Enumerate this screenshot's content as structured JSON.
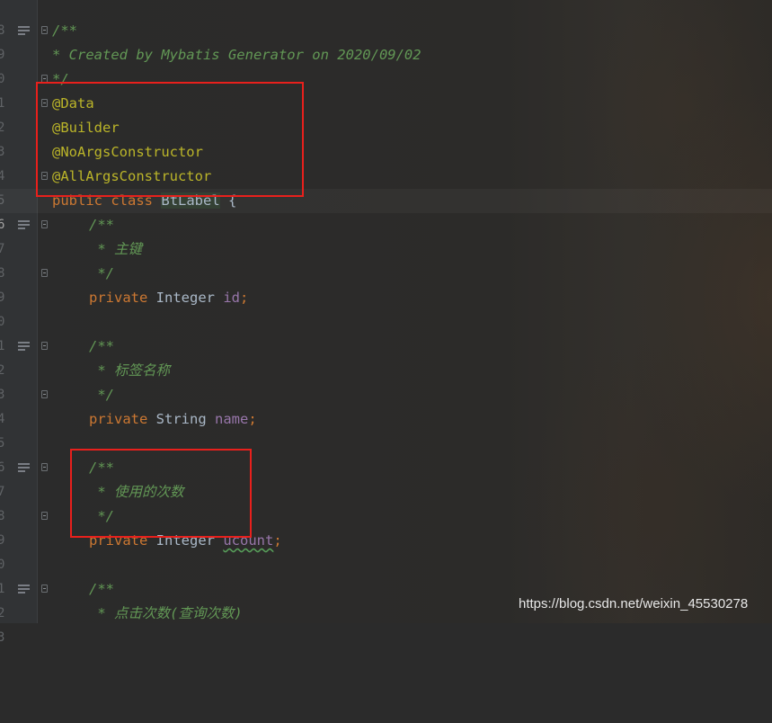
{
  "editor": {
    "lines": [
      {
        "n": "8"
      },
      {
        "n": "9",
        "doc": "/**"
      },
      {
        "n": "0",
        "doc": "* Created by Mybatis Generator on 2020/09/02"
      },
      {
        "n": "1",
        "doc": "*/"
      },
      {
        "n": "2",
        "ann": "@Data"
      },
      {
        "n": "3",
        "ann": "@Builder"
      },
      {
        "n": "4",
        "ann": "@NoArgsConstructor"
      },
      {
        "n": "5",
        "ann": "@AllArgsConstructor"
      },
      {
        "n": "6",
        "kw1": "public",
        "kw2": "class",
        "cls": "BtLabel",
        "rest": " {"
      },
      {
        "n": "7",
        "doc": "/**"
      },
      {
        "n": "8",
        "doc": " * 主键"
      },
      {
        "n": "9",
        "doc": " */"
      },
      {
        "n": "0",
        "kw": "private",
        "type": "Integer",
        "field": "id",
        "end": ";"
      },
      {
        "n": "1"
      },
      {
        "n": "2",
        "doc": "/**"
      },
      {
        "n": "3",
        "doc": " * 标签名称"
      },
      {
        "n": "4",
        "doc": " */"
      },
      {
        "n": "5",
        "kw": "private",
        "type": "String",
        "field": "name",
        "end": ";"
      },
      {
        "n": "6"
      },
      {
        "n": "7",
        "doc": "/**"
      },
      {
        "n": "8",
        "doc": " * 使用的次数"
      },
      {
        "n": "9",
        "doc": " */"
      },
      {
        "n": "0",
        "kw": "private",
        "type": "Integer",
        "field": "ucount",
        "end": ";"
      },
      {
        "n": "1"
      },
      {
        "n": "2",
        "doc": "/**"
      },
      {
        "n": "3",
        "doc": " * 点击次数(查询次数)"
      }
    ]
  },
  "watermark": "https://blog.csdn.net/weixin_45530278",
  "colors": {
    "background": "#2b2b2b",
    "doc_comment": "#629755",
    "annotation": "#bbb529",
    "keyword": "#cc7832",
    "field": "#9876aa",
    "highlight_box": "#e8201c"
  },
  "icons": {
    "doc_toggle": "doc-comment-toggle-icon",
    "fold": "fold-marker-icon"
  }
}
